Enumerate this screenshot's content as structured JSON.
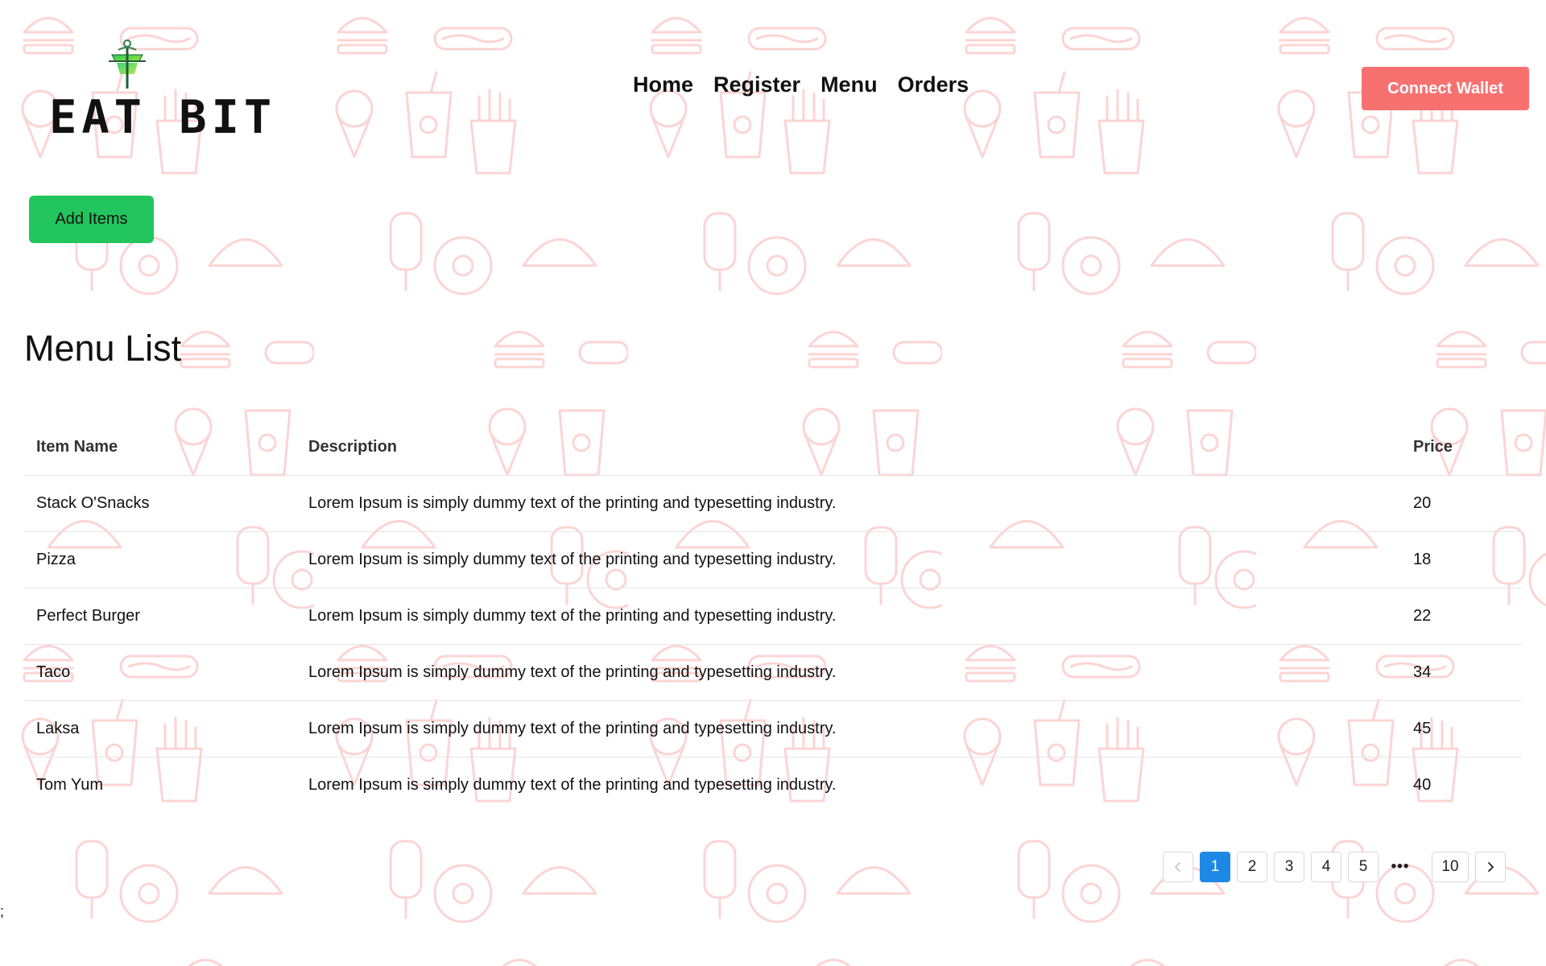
{
  "brand": {
    "name": "EAT BIT"
  },
  "nav": {
    "items": [
      {
        "label": "Home"
      },
      {
        "label": "Register"
      },
      {
        "label": "Menu"
      },
      {
        "label": "Orders"
      }
    ]
  },
  "header": {
    "connect_wallet_label": "Connect Wallet"
  },
  "actions": {
    "add_items_label": "Add Items"
  },
  "main": {
    "title": "Menu List"
  },
  "table": {
    "columns": [
      "Item Name",
      "Description",
      "Price"
    ],
    "rows": [
      {
        "name": "Stack O'Snacks",
        "description": "Lorem Ipsum is simply dummy text of the printing and typesetting industry.",
        "price": "20"
      },
      {
        "name": "Pizza",
        "description": "Lorem Ipsum is simply dummy text of the printing and typesetting industry.",
        "price": "18"
      },
      {
        "name": "Perfect Burger",
        "description": "Lorem Ipsum is simply dummy text of the printing and typesetting industry.",
        "price": "22"
      },
      {
        "name": "Taco",
        "description": "Lorem Ipsum is simply dummy text of the printing and typesetting industry.",
        "price": "34"
      },
      {
        "name": "Laksa",
        "description": "Lorem Ipsum is simply dummy text of the printing and typesetting industry.",
        "price": "45"
      },
      {
        "name": "Tom Yum",
        "description": "Lorem Ipsum is simply dummy text of the printing and typesetting industry.",
        "price": "40"
      }
    ]
  },
  "pagination": {
    "prev_icon": "chevron-left-icon",
    "pages": [
      "1",
      "2",
      "3",
      "4",
      "5"
    ],
    "current": "1",
    "ellipsis": "•••",
    "last": "10",
    "next_icon": "chevron-right-icon"
  },
  "stray_text": ";",
  "colors": {
    "connect_wallet_bg": "#f87171",
    "add_items_bg": "#22c55e",
    "active_page_bg": "#1e88e5",
    "pattern_stroke": "#fbd5d5"
  }
}
